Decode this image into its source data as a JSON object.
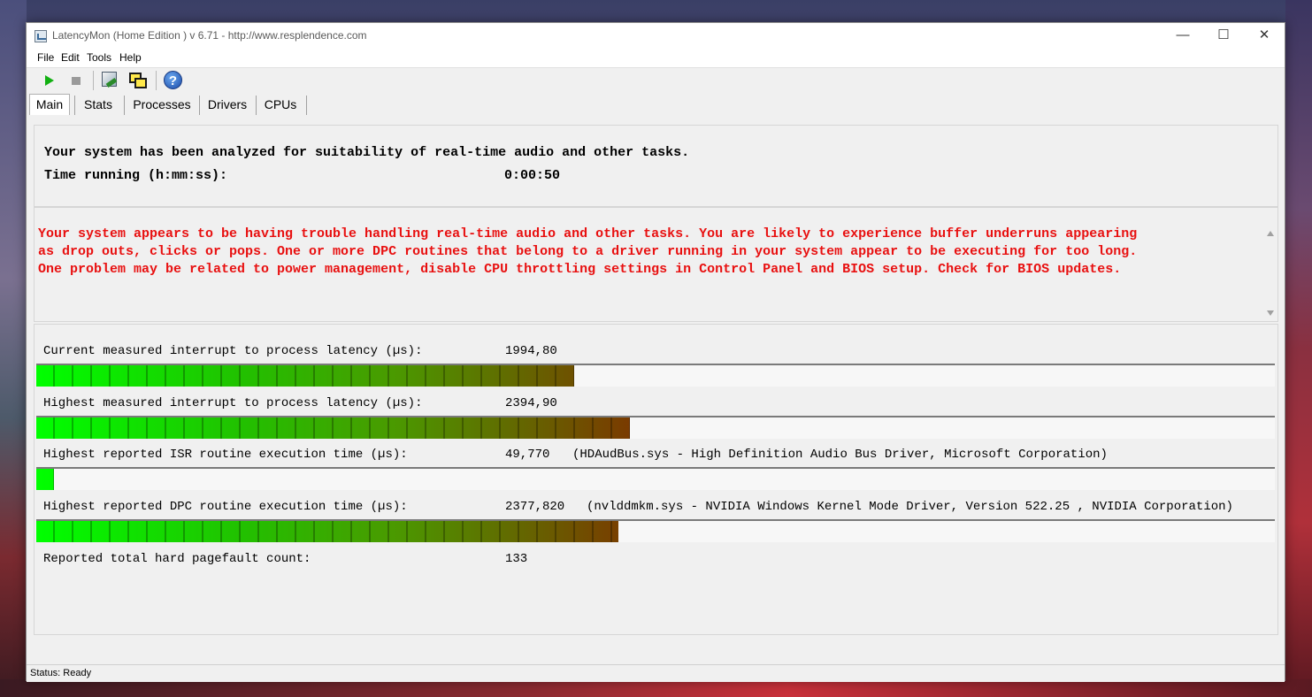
{
  "window": {
    "title": "LatencyMon  (Home Edition )  v 6.71 - http://www.resplendence.com",
    "controls": {
      "minimize": "—",
      "maximize": "☐",
      "close": "✕"
    }
  },
  "menu": [
    "File",
    "Edit",
    "Tools",
    "Help"
  ],
  "toolbar": {
    "buttons": [
      "play-icon",
      "stop-icon",
      "tool-icon",
      "windows-icon",
      "help-icon"
    ],
    "help_glyph": "?"
  },
  "tabs": [
    "Main",
    "Stats",
    "Processes",
    "Drivers",
    "CPUs"
  ],
  "summary": {
    "line1": "Your system has been analyzed for suitability of real-time audio and other tasks.",
    "time_label": "Time running (h:mm:ss):",
    "time_value": "0:00:50"
  },
  "message": "Your system appears to be having trouble handling real-time audio and other tasks. You are likely to experience buffer underruns appearing\nas drop outs, clicks or pops. One or more DPC routines that belong to a driver running in your system appear to be executing for too long.\nOne problem may be related to power management, disable CPU throttling settings in Control Panel and BIOS setup. Check for BIOS updates.",
  "stats": {
    "current_latency": {
      "label": "Current measured interrupt to process latency (µs):",
      "value": "1994,80",
      "bar_fraction": 0.434
    },
    "highest_latency": {
      "label": "Highest measured interrupt to process latency (µs):",
      "value": "2394,90",
      "bar_fraction": 0.479
    },
    "highest_isr": {
      "label": "Highest reported ISR routine execution time (µs):",
      "value": "49,770",
      "extra": "(HDAudBus.sys - High Definition Audio Bus Driver, Microsoft Corporation)",
      "bar_fraction": 0.014
    },
    "highest_dpc": {
      "label": "Highest reported DPC routine execution time (µs):",
      "value": "2377,820",
      "extra": "(nvlddmkm.sys - NVIDIA Windows Kernel Mode Driver, Version 522.25 , NVIDIA Corporation)",
      "bar_fraction": 0.47
    },
    "pagefault": {
      "label": "Reported total hard pagefault count:",
      "value": "133"
    }
  },
  "status": "Status: Ready",
  "colors": {
    "warning": "#e81010",
    "bar_start": "#00ff00",
    "bar_end": "#7a3a00"
  }
}
